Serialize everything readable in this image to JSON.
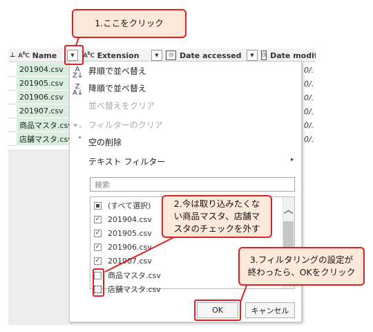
{
  "grid": {
    "columns": [
      {
        "name": "Name",
        "type_icon": "ABC"
      },
      {
        "name": "Extension",
        "type_icon": "ABC"
      },
      {
        "name": "Date accessed",
        "type_icon": "calendar-clock"
      },
      {
        "name": "Date modifi",
        "type_icon": "calendar-clock"
      }
    ],
    "rows": [
      "201904.csv",
      "201905.csv",
      "201906.csv",
      "201907.csv",
      "商品マスタ.csv",
      "店舗マスタ.csv"
    ],
    "right_values": [
      "0/.",
      "0/.",
      "0/.",
      "0/.",
      "0/.",
      "0/."
    ]
  },
  "menu": {
    "sort_asc": "昇順で並べ替え",
    "sort_desc": "降順で並べ替え",
    "sort_clear": "並べ替えをクリア",
    "filter_clear": "フィルターのクリア",
    "remove_empty": "空の削除",
    "text_filter": "テキスト フィルター",
    "search_placeholder": "検索",
    "items": [
      {
        "label": "(すべて選択)",
        "state": "partial"
      },
      {
        "label": "201904.csv",
        "state": "checked"
      },
      {
        "label": "201905.csv",
        "state": "checked"
      },
      {
        "label": "201906.csv",
        "state": "checked"
      },
      {
        "label": "201907.csv",
        "state": "checked"
      },
      {
        "label": "商品マスタ.csv",
        "state": "unchecked"
      },
      {
        "label": "店舗マスタ.csv",
        "state": "unchecked-focus"
      }
    ],
    "ok": "OK",
    "cancel": "キャンセル"
  },
  "callouts": {
    "c1": "1.ここをクリック",
    "c2_line1": "2.今は取り込みたくな",
    "c2_line2": "い商品マスタ、店舗マ",
    "c2_line3": "スタのチェックを外す",
    "c3_line1": "3.フィルタリングの設定が",
    "c3_line2": "終わったら、OKをクリック"
  },
  "colors": {
    "accent": "#e02020",
    "callout_bg": "#fde9d9",
    "row_highlight": "#d8efe0"
  }
}
